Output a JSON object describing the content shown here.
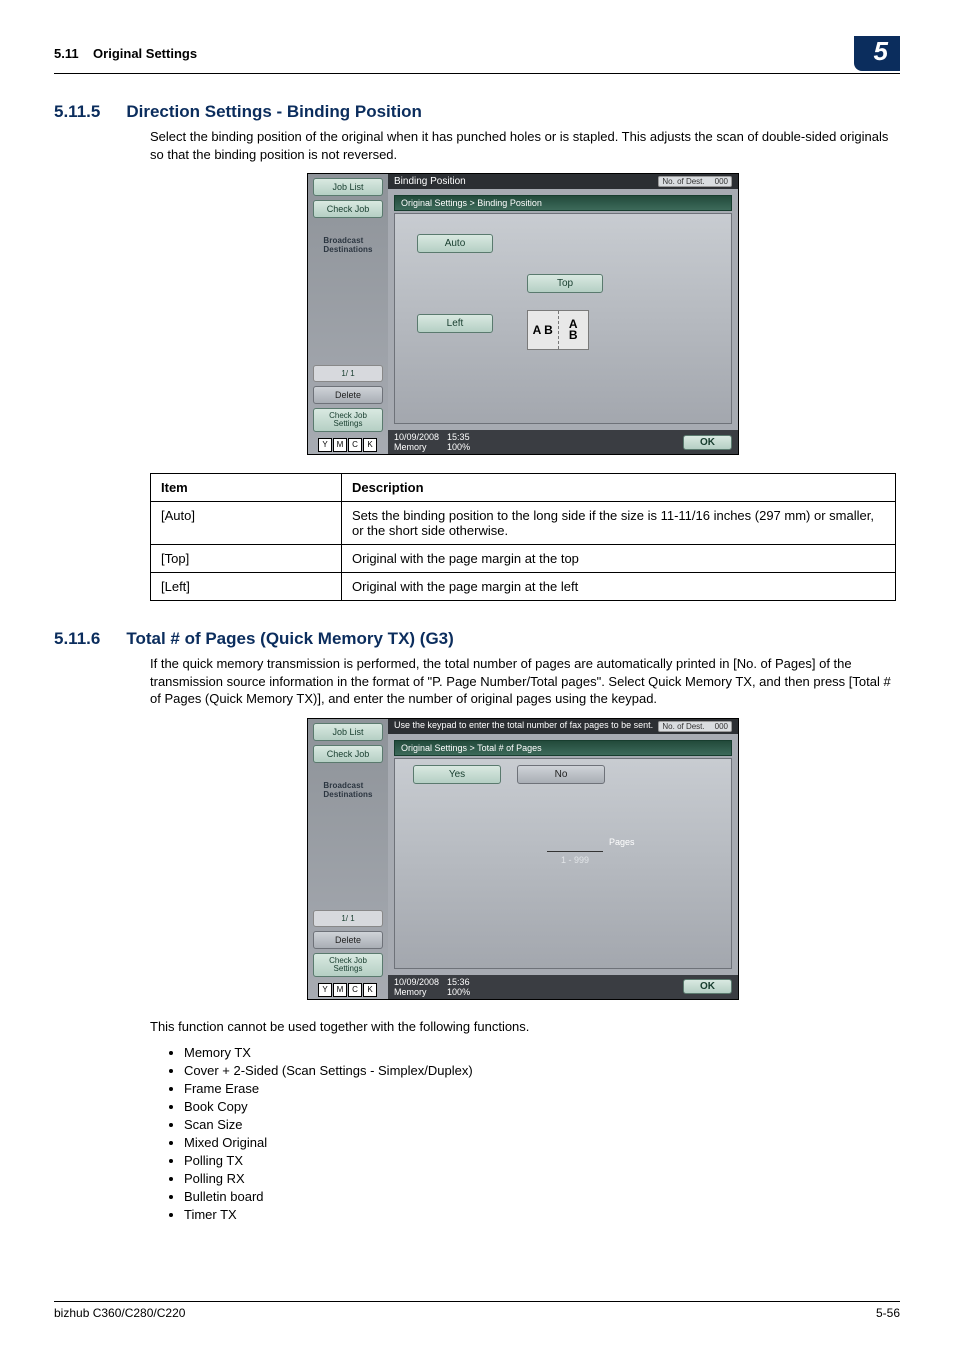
{
  "header": {
    "section_ref": "5.11",
    "section_title": "Original Settings",
    "chapter_number": "5"
  },
  "sec1": {
    "number": "5.11.5",
    "title": "Direction Settings - Binding Position",
    "para": "Select the binding position of the original when it has punched holes or is stapled. This adjusts the scan of double-sided originals so that the binding position is not reversed."
  },
  "shot1": {
    "sidebar": {
      "job_list": "Job List",
      "check_job": "Check Job",
      "broadcast": "Broadcast\nDestinations",
      "page_counter": "1/   1",
      "delete": "Delete",
      "check_settings": "Check Job\nSettings"
    },
    "title": "Binding Position",
    "dest_label": "No. of Dest.",
    "dest_count": "000",
    "breadcrumb": "Original Settings > Binding Position",
    "btn_auto": "Auto",
    "btn_top": "Top",
    "btn_left": "Left",
    "diag1": "A B",
    "diag2": "A\nB",
    "status": {
      "date": "10/09/2008",
      "time": "15:35",
      "mem_label": "Memory",
      "mem_val": "100%",
      "ok": "OK"
    }
  },
  "table1": {
    "h_item": "Item",
    "h_desc": "Description",
    "rows": [
      {
        "item": "[Auto]",
        "desc": "Sets the binding position to the long side if the size is 11-11/16 inches (297 mm) or smaller, or the short side otherwise."
      },
      {
        "item": "[Top]",
        "desc": "Original with the page margin at the top"
      },
      {
        "item": "[Left]",
        "desc": "Original with the page margin at the left"
      }
    ]
  },
  "sec2": {
    "number": "5.11.6",
    "title": "Total # of Pages (Quick Memory TX) (G3)",
    "para": "If the quick memory transmission is performed, the total number of pages are automatically printed in [No. of Pages] of the transmission source information in the format of \"P. Page Number/Total pages\". Select Quick Memory TX, and then press [Total # of Pages (Quick Memory TX)], and enter the number of original pages using the keypad."
  },
  "shot2": {
    "title": "Use the keypad to enter the total number of fax pages to be sent.",
    "breadcrumb": "Original Settings > Total # of Pages",
    "btn_yes": "Yes",
    "btn_no": "No",
    "pages_label": "Pages",
    "range": "1  -  999",
    "status": {
      "date": "10/09/2008",
      "time": "15:36",
      "mem_label": "Memory",
      "mem_val": "100%",
      "ok": "OK"
    }
  },
  "lead2": "This function cannot be used together with the following functions.",
  "bullets": [
    "Memory TX",
    "Cover + 2-Sided (Scan Settings - Simplex/Duplex)",
    "Frame Erase",
    "Book Copy",
    "Scan Size",
    "Mixed Original",
    "Polling TX",
    "Polling RX",
    "Bulletin board",
    "Timer TX"
  ],
  "footer": {
    "model": "bizhub C360/C280/C220",
    "page": "5-56"
  }
}
